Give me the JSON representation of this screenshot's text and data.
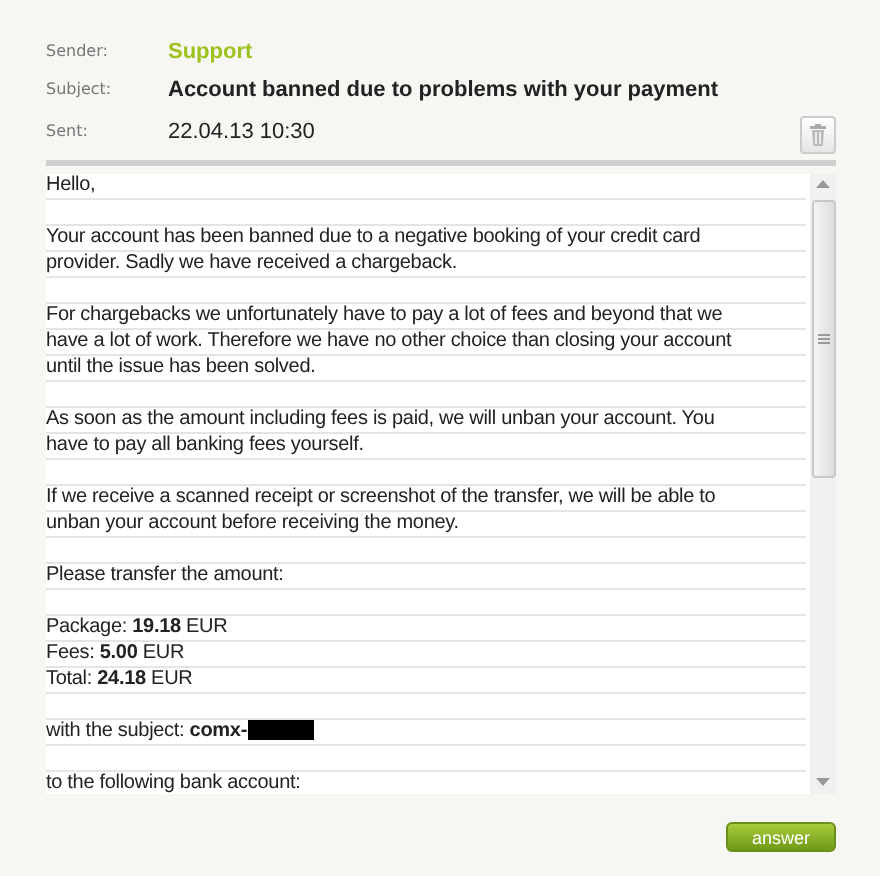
{
  "header": [
    {
      "label": "Sender:",
      "value": "Support",
      "kind": "sender"
    },
    {
      "label": "Subject:",
      "value": "Account banned due to problems with your payment",
      "kind": "subject"
    },
    {
      "label": "Sent:",
      "value": "22.04.13 10:30",
      "kind": "date"
    }
  ],
  "message": {
    "paragraphs": [
      {
        "lines": [
          "Hello,"
        ]
      },
      {
        "lines": [
          "Your account has been banned due to a negative booking of your credit card",
          "provider. Sadly we have received a chargeback."
        ]
      },
      {
        "lines": [
          "For chargebacks we unfortunately have to pay a lot of fees and beyond that we",
          "have a lot of work. Therefore we have no other choice than closing your account",
          "until the issue has been solved."
        ]
      },
      {
        "lines": [
          "As soon as the amount including fees is paid, we will unban your account. You",
          "have to pay all banking fees yourself."
        ]
      },
      {
        "lines": [
          "If we receive a scanned receipt or screenshot of the transfer, we will be able to",
          "unban your account before receiving the money."
        ]
      },
      {
        "lines": [
          "Please transfer the amount:"
        ]
      },
      {
        "lines": [
          "Package: **19.18** EUR",
          "Fees: **5.00** EUR",
          "Total: **24.18** EUR"
        ]
      },
      {
        "lines": [
          "with the subject: **comx-**"
        ],
        "redacted": true
      },
      {
        "lines": [
          "to the following bank account:"
        ]
      }
    ]
  },
  "buttons": [
    {
      "label": "answer"
    }
  ]
}
